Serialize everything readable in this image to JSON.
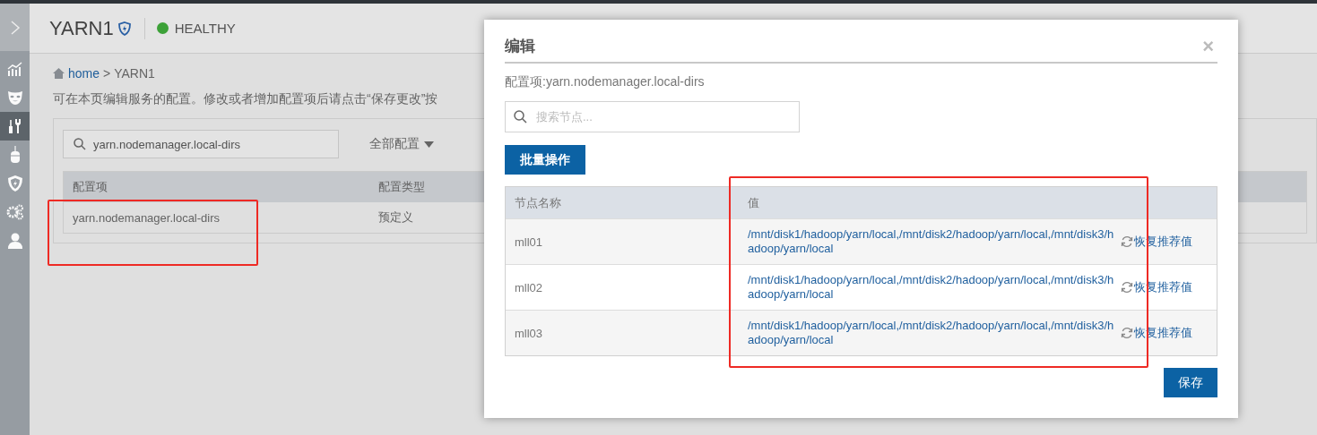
{
  "sidebar": {
    "items": [
      {
        "kind": "expand",
        "selected": false
      },
      {
        "kind": "chart",
        "selected": false
      },
      {
        "kind": "mask",
        "selected": false
      },
      {
        "kind": "tools",
        "selected": true
      },
      {
        "kind": "mouse",
        "selected": false
      },
      {
        "kind": "shield",
        "selected": false
      },
      {
        "kind": "gears",
        "selected": false
      },
      {
        "kind": "user",
        "selected": false
      }
    ]
  },
  "header": {
    "title": "YARN1",
    "status": {
      "label": "HEALTHY",
      "healthy": true
    }
  },
  "breadcrumb": {
    "home": "home",
    "separator": ">",
    "current": "YARN1"
  },
  "description": "可在本页编辑服务的配置。修改或者增加配置项后请点击“保存更改”按",
  "config_panel": {
    "search": {
      "value": "yarn.nodemanager.local-dirs"
    },
    "filter": "全部配置",
    "table": {
      "columns": [
        "配置项",
        "配置类型"
      ],
      "rows": [
        [
          "yarn.nodemanager.local-dirs",
          "预定义"
        ]
      ]
    }
  },
  "dialog": {
    "title": "编辑",
    "close": "×",
    "config_item": "配置项:yarn.nodemanager.local-dirs",
    "search": {
      "placeholder": "搜索节点..."
    },
    "batch_button": "批量操作",
    "table": {
      "columns": [
        "节点名称",
        "值"
      ],
      "rows": [
        {
          "node": "mll01",
          "value": "/mnt/disk1/hadoop/yarn/local,/mnt/disk2/hadoop/yarn/local,/mnt/disk3/hadoop/yarn/local",
          "action": "恢复推荐值"
        },
        {
          "node": "mll02",
          "value": "/mnt/disk1/hadoop/yarn/local,/mnt/disk2/hadoop/yarn/local,/mnt/disk3/hadoop/yarn/local",
          "action": "恢复推荐值"
        },
        {
          "node": "mll03",
          "value": "/mnt/disk1/hadoop/yarn/local,/mnt/disk2/hadoop/yarn/local,/mnt/disk3/hadoop/yarn/local",
          "action": "恢复推荐值"
        }
      ]
    },
    "save_button": "保存"
  }
}
